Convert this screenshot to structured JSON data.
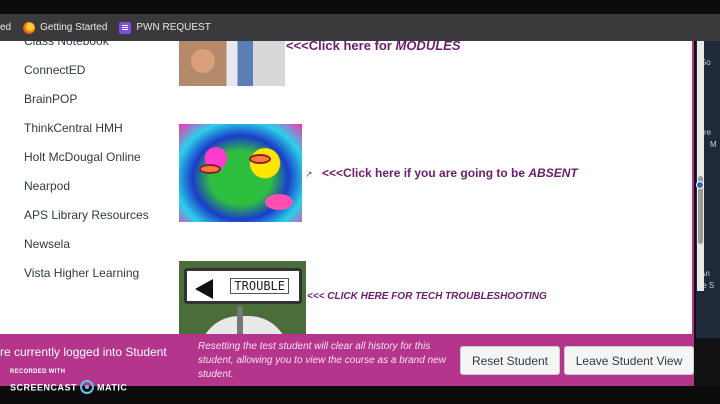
{
  "bookmarks": {
    "items": [
      {
        "label": "ed",
        "icon": "none"
      },
      {
        "label": "Getting Started",
        "icon": "firefox-icon"
      },
      {
        "label": "PWN REQUEST",
        "icon": "forms-icon"
      }
    ]
  },
  "nav": {
    "items": [
      "Class Notebook",
      "ConnectED",
      "BrainPOP",
      "ThinkCentral HMH",
      "Holt McDougal Online",
      "Nearpod",
      "APS Library Resources",
      "Newsela",
      "Vista Higher Learning"
    ]
  },
  "content": {
    "modules_link_prefix": "<<<Click here for ",
    "modules_link_em": "MODULES",
    "absent_link_prefix": "<<<Click here if you are going to be ",
    "absent_link_em": "ABSENT",
    "tech_link": "<<< CLICK HERE FOR TECH TROUBLESHOOTING",
    "trouble_sign": "TROUBLE",
    "external_icon": "↗"
  },
  "banner": {
    "status": "re currently logged into Student",
    "description": "Resetting the test student will clear all history for this student, allowing you to view the course as a brand new student.",
    "reset_label": "Reset Student",
    "leave_label": "Leave Student View",
    "color": "#b5358c"
  },
  "right_peek": [
    "Go",
    "cre",
    "M",
    "An",
    "fe S",
    "syc",
    "e C"
  ],
  "watermark": {
    "small": "RECORDED WITH",
    "left": "SCREENCAST",
    "right": "MATIC"
  }
}
